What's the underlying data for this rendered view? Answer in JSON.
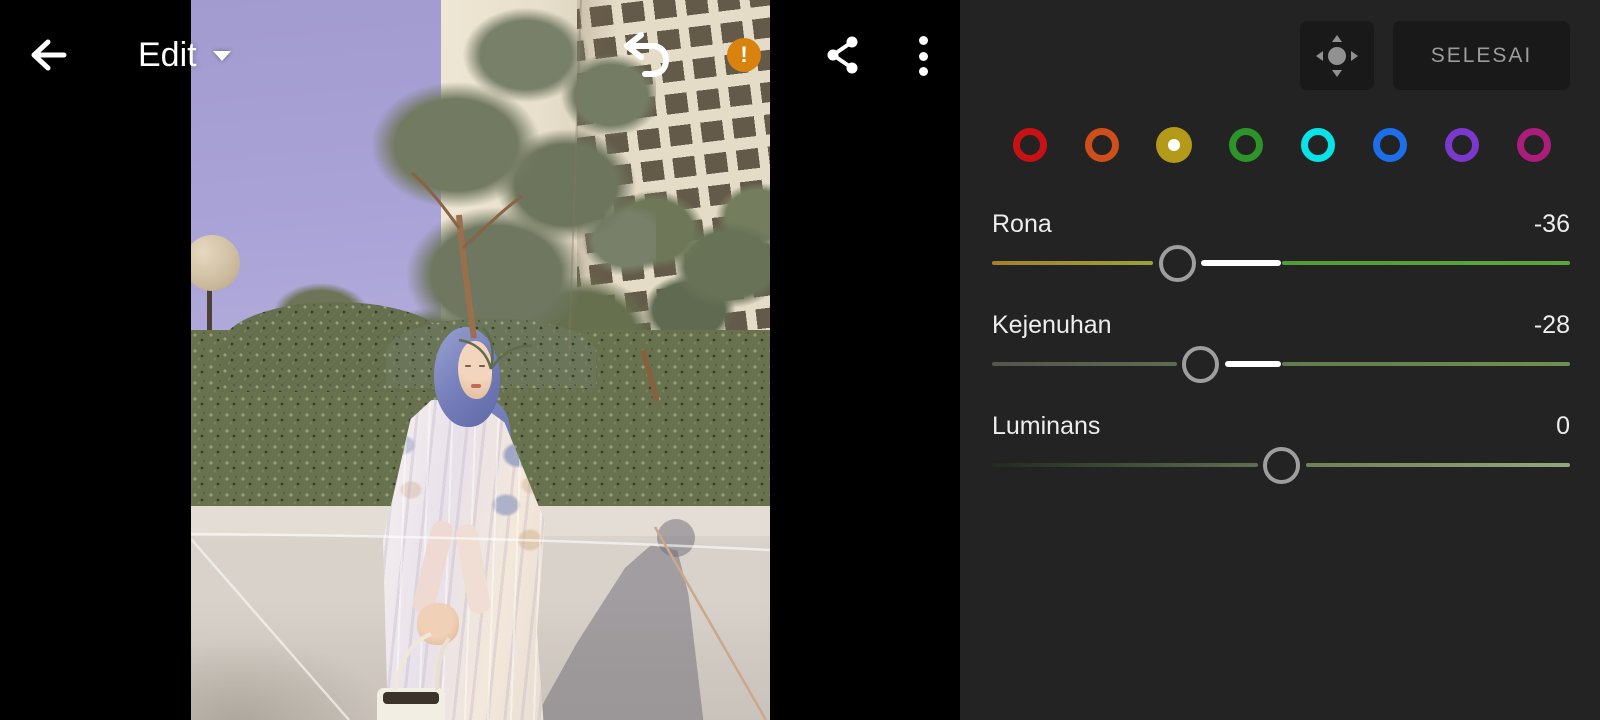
{
  "header": {
    "title": "Edit",
    "warning_glyph": "!"
  },
  "photo": {
    "alt": "Woman wearing a periwinkle blue hijab and a shiny white floral-print kaftan, holding a small cream tote bag, standing on sunlit concrete pavement in front of a tall clipped hedge, a large olive-green tree, a round lamp post globe and a beige high-rise building with a grid of windows under a lavender sky; her shadow falls on the pavement to the right.",
    "colors": {
      "sky": "#aaa3d7",
      "hijab": "#7982bd",
      "hedge": "#68724f",
      "pavement": "#d8d2ca",
      "building": "#e5dcc8"
    }
  },
  "panel": {
    "background": "#232323",
    "done_label": "SELESAI",
    "channels": [
      {
        "name": "red",
        "color": "#c81114",
        "selected": false
      },
      {
        "name": "orange",
        "color": "#cf4f1c",
        "selected": false
      },
      {
        "name": "yellow",
        "color": "#b39a18",
        "selected": true
      },
      {
        "name": "green",
        "color": "#2d9429",
        "selected": false
      },
      {
        "name": "aqua",
        "color": "#09e3e8",
        "selected": false
      },
      {
        "name": "blue",
        "color": "#1c6fe8",
        "selected": false
      },
      {
        "name": "purple",
        "color": "#7a38cc",
        "selected": false
      },
      {
        "name": "magenta",
        "color": "#aa1d7a",
        "selected": false
      }
    ],
    "sliders": [
      {
        "key": "hue",
        "label": "Rona",
        "value": -36,
        "display": "-36",
        "track_left": [
          "#a5802e",
          "#9aa23c"
        ],
        "track_right": [
          "#4f9c39",
          "#58a83d"
        ]
      },
      {
        "key": "saturation",
        "label": "Kejenuhan",
        "value": -28,
        "display": "-28",
        "track_left": [
          "#55544e",
          "#5f6b52"
        ],
        "track_right": [
          "#647a4e",
          "#6f9150"
        ]
      },
      {
        "key": "luminance",
        "label": "Luminans",
        "value": 0,
        "display": "0",
        "track_left": [
          "#232a1e",
          "#5f7050"
        ],
        "track_right": [
          "#6f8157",
          "#94a87d"
        ]
      }
    ]
  }
}
